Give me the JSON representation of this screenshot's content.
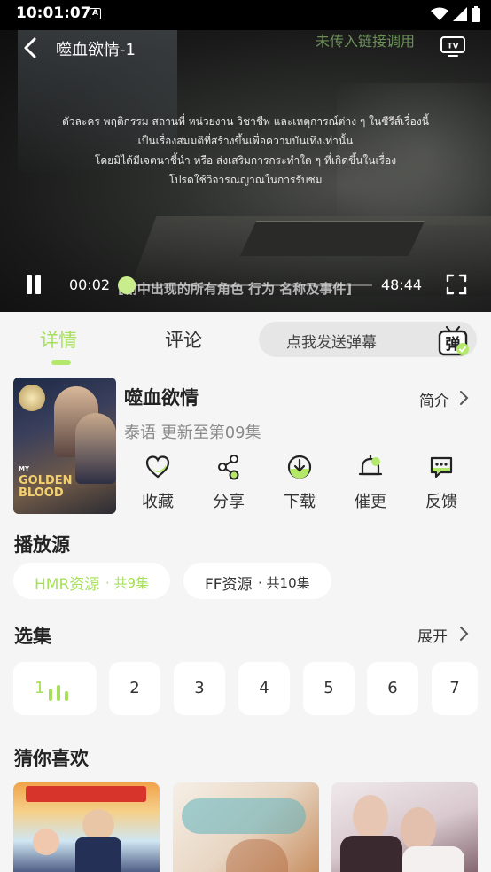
{
  "status_bar": {
    "time": "10:01:07",
    "notification_letter": "A"
  },
  "player": {
    "title": "噬血欲情-1",
    "watermark": "未传入链接调用",
    "thai_disclaimer": [
      "ตัวละคร พฤติกรรม สถานที่ หน่วยงาน วิชาชีพ และเหตุการณ์ต่าง ๆ ในซีรีส์เรื่องนี้",
      "เป็นเรื่องสมมติที่สร้างขึ้นเพื่อความบันเทิงเท่านั้น",
      "โดยมิได้มีเจตนาชี้นำ หรือ ส่งเสริมการกระทำใด ๆ ที่เกิดขึ้นในเรื่อง",
      "โปรดใช้วิจารณญาณในการรับชม"
    ],
    "danmaku_text": "[剧中出现的所有角色 行为 名称及事件]",
    "current_time": "00:02",
    "total_time": "48:44",
    "progress_fraction": 0.0007,
    "icons": [
      "back-icon",
      "cast-tv-icon",
      "pause-icon",
      "fullscreen-icon"
    ]
  },
  "tabs": {
    "items": [
      {
        "label": "详情"
      },
      {
        "label": "评论"
      }
    ],
    "active": 0,
    "danmaku_placeholder": "点我发送弹幕",
    "danmaku_button": "弹"
  },
  "show": {
    "title": "噬血欲情",
    "meta": "泰语 更新至第09集",
    "intro_label": "简介",
    "poster_title_line1": "MY",
    "poster_title_line2": "GOLDEN",
    "poster_title_line3": "BLOOD",
    "actions": [
      {
        "label": "收藏",
        "icon": "heart-icon"
      },
      {
        "label": "分享",
        "icon": "share-icon"
      },
      {
        "label": "下载",
        "icon": "download-icon"
      },
      {
        "label": "催更",
        "icon": "bell-icon"
      },
      {
        "label": "反馈",
        "icon": "feedback-icon"
      }
    ]
  },
  "sources": {
    "title": "播放源",
    "items": [
      {
        "name": "HMR资源",
        "count": "· 共9集",
        "selected": true
      },
      {
        "name": "FF资源",
        "count": "· 共10集",
        "selected": false
      }
    ]
  },
  "episodes": {
    "title": "选集",
    "expand_label": "展开",
    "items": [
      "1",
      "2",
      "3",
      "4",
      "5",
      "6",
      "7"
    ],
    "active": "1"
  },
  "recommend": {
    "title": "猜你喜欢"
  },
  "colors": {
    "accent": "#a6e05a",
    "accent_light": "#c9ec8c",
    "background": "#f5f5f5"
  }
}
